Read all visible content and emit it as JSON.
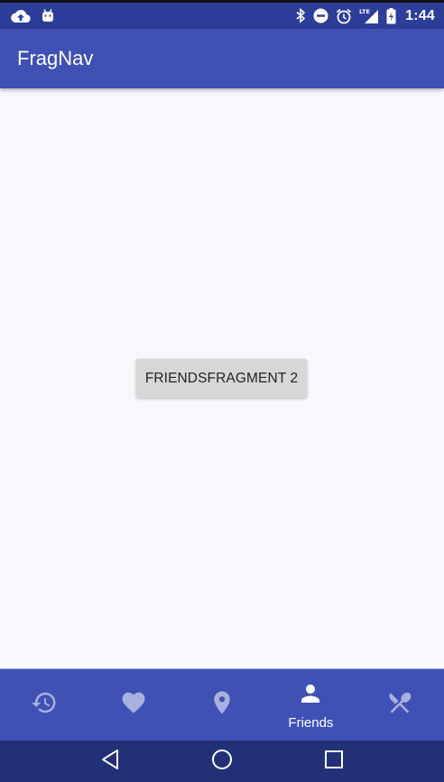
{
  "status_bar": {
    "time": "1:44",
    "lte_label": "LTE",
    "left_icons": [
      "cloud-upload-icon",
      "android-icon"
    ],
    "right_icons": [
      "bluetooth-icon",
      "do-not-disturb-icon",
      "alarm-icon",
      "lte-signal-icon",
      "battery-charging-icon"
    ]
  },
  "app_bar": {
    "title": "FragNav"
  },
  "content": {
    "button_label": "FRIENDSFRAGMENT 2"
  },
  "bottom_nav": {
    "items": [
      {
        "icon": "history-icon",
        "label": "",
        "active": false
      },
      {
        "icon": "heart-icon",
        "label": "",
        "active": false
      },
      {
        "icon": "location-pin-icon",
        "label": "",
        "active": false
      },
      {
        "icon": "person-icon",
        "label": "Friends",
        "active": true
      },
      {
        "icon": "restaurant-icon",
        "label": "",
        "active": false
      }
    ]
  },
  "system_nav": {
    "buttons": [
      "back-icon",
      "home-icon",
      "recents-icon"
    ]
  },
  "colors": {
    "status_bar": "#2d3d9a",
    "app_bar": "#3f51b5",
    "bottom_nav": "#3f51b5",
    "system_nav": "#223078",
    "background": "#f8f7fb",
    "button": "#d8d7d8"
  }
}
